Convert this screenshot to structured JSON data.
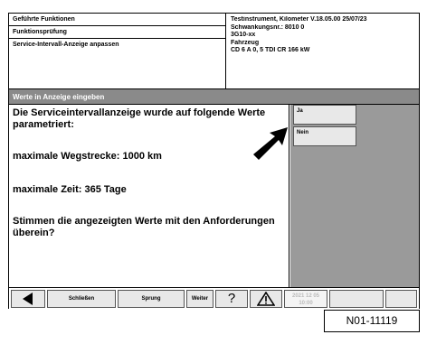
{
  "header": {
    "left": {
      "row1": "Geführte Funktionen",
      "row2": "Funktionsprüfung",
      "row3": "Service-Intervall-Anzeige anpassen"
    },
    "right": {
      "line1": "Testinstrument, Kilometer V.18.05.00 25/07/23",
      "line2": "Schwankungsnr.: 8010 0",
      "line3": "3G10-xx",
      "line4": "Fahrzeug",
      "line5": "CD 6 A 0, 5 TDI CR 166 kW"
    }
  },
  "title": "Werte in Anzeige eingeben",
  "content": {
    "p1": "Die Serviceintervallanzeige wurde auf folgende Werte parametriert:",
    "p2": "maximale Wegstrecke: 1000 km",
    "p3": "maximale Zeit: 365 Tage",
    "p4": "Stimmen die angezeigten Werte mit den Anforderungen überein?"
  },
  "side": {
    "yes_label": "Ja",
    "no_label": "Nein"
  },
  "footer": {
    "info_label": "Schließen",
    "print_label": "Sprung",
    "next_label": "Weiter",
    "help_label": "?",
    "dim_label": "2021 12 05 10:00"
  },
  "caption": "N01-11119"
}
